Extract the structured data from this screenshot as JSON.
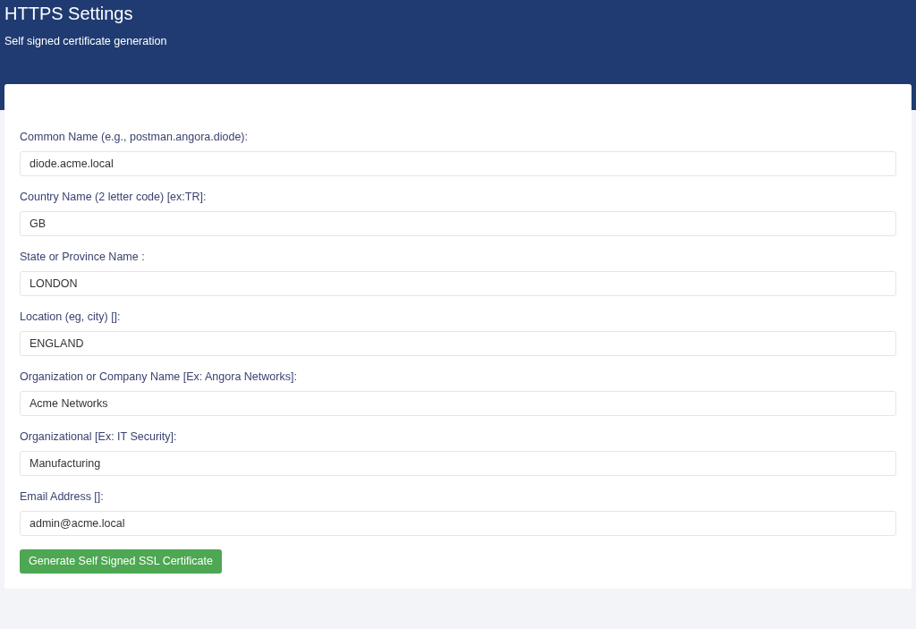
{
  "header": {
    "title": "HTTPS Settings",
    "subtitle": "Self signed certificate generation"
  },
  "fields": [
    {
      "label": "Common Name (e.g., postman.angora.diode):",
      "value": "diode.acme.local"
    },
    {
      "label": "Country Name (2 letter code) [ex:TR]:",
      "value": "GB"
    },
    {
      "label": "State or Province Name :",
      "value": "LONDON"
    },
    {
      "label": "Location (eg, city) []:",
      "value": "ENGLAND"
    },
    {
      "label": "Organization or Company Name [Ex: Angora Networks]:",
      "value": "Acme Networks"
    },
    {
      "label": "Organizational [Ex: IT Security]:",
      "value": "Manufacturing"
    },
    {
      "label": "Email Address []:",
      "value": "admin@acme.local"
    }
  ],
  "button": "Generate Self Signed SSL Certificate"
}
